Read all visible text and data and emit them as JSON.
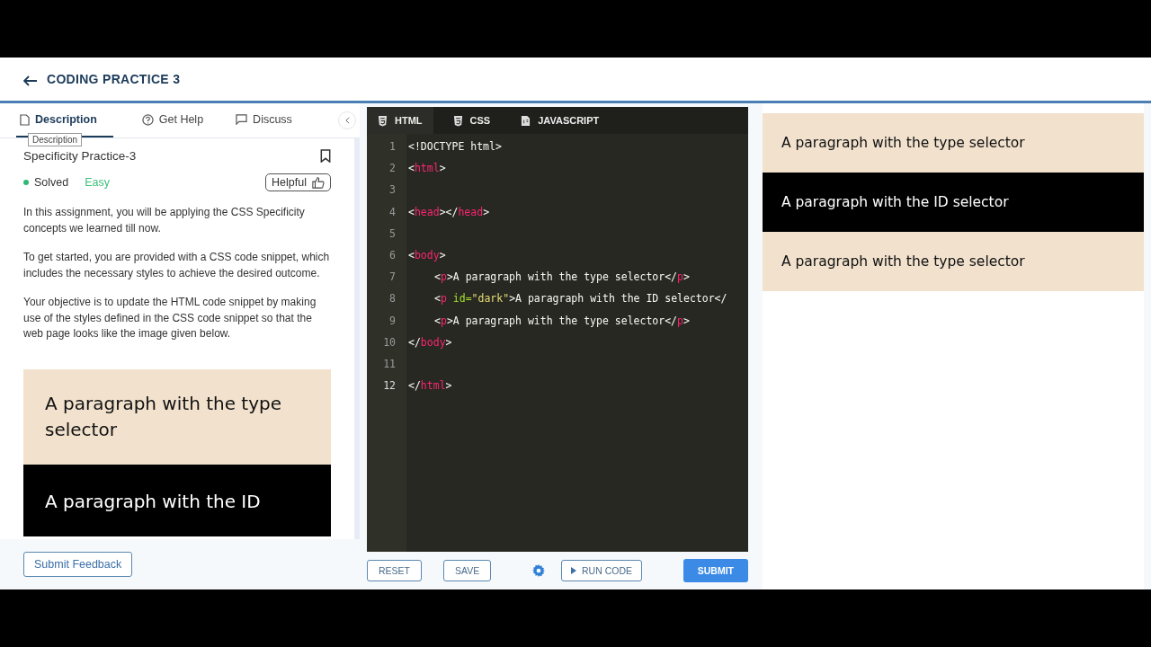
{
  "header": {
    "title": "CODING PRACTICE 3"
  },
  "left_tabs": [
    {
      "label": "Description",
      "kind": "doc",
      "selected": true
    },
    {
      "label": "Get Help",
      "kind": "help",
      "selected": false
    },
    {
      "label": "Discuss",
      "kind": "chat",
      "selected": false
    }
  ],
  "tooltip": "Description",
  "problem": {
    "title": "Specificity Practice-3",
    "status": "Solved",
    "difficulty": "Easy",
    "helpful": "Helpful",
    "paragraphs": [
      "In this assignment, you will be applying the CSS Specificity concepts we learned till now.",
      "To get started, you are provided with a CSS code snippet, which includes the necessary styles to achieve the desired outcome.",
      "Your objective is to update the HTML code snippet by making use of the styles defined in the CSS code snippet so that the web page looks like the image given below."
    ],
    "sample": [
      {
        "text": "A paragraph with the type selector",
        "kind": "light"
      },
      {
        "text": "A paragraph with the ID",
        "kind": "dark"
      }
    ]
  },
  "feedback_button": "Submit Feedback",
  "editor_tabs": [
    {
      "label": "HTML",
      "kind": "html",
      "selected": true
    },
    {
      "label": "CSS",
      "kind": "css",
      "selected": false
    },
    {
      "label": "JAVASCRIPT",
      "kind": "js",
      "selected": false
    }
  ],
  "code_lines": [
    {
      "n": "1",
      "indent": false,
      "tokens": [
        {
          "kind": "punct",
          "text": "<!DOCTYPE html>"
        }
      ]
    },
    {
      "n": "2",
      "indent": false,
      "tokens": [
        {
          "kind": "punct",
          "text": "<"
        },
        {
          "kind": "tag",
          "text": "html"
        },
        {
          "kind": "punct",
          "text": ">"
        }
      ]
    },
    {
      "n": "3"
    },
    {
      "n": "4",
      "indent": false,
      "tokens": [
        {
          "kind": "punct",
          "text": "<"
        },
        {
          "kind": "tag",
          "text": "head"
        },
        {
          "kind": "punct",
          "text": "></"
        },
        {
          "kind": "tag",
          "text": "head"
        },
        {
          "kind": "punct",
          "text": ">"
        }
      ]
    },
    {
      "n": "5"
    },
    {
      "n": "6",
      "indent": false,
      "tokens": [
        {
          "kind": "punct",
          "text": "<"
        },
        {
          "kind": "tag",
          "text": "body"
        },
        {
          "kind": "punct",
          "text": ">"
        }
      ]
    },
    {
      "n": "7",
      "indent": true,
      "tokens": [
        {
          "kind": "punct",
          "text": "<"
        },
        {
          "kind": "tag",
          "text": "p"
        },
        {
          "kind": "punct",
          "text": ">A paragraph with the type selector</"
        },
        {
          "kind": "tag",
          "text": "p"
        },
        {
          "kind": "punct",
          "text": ">"
        }
      ]
    },
    {
      "n": "8",
      "indent": true,
      "tokens": [
        {
          "kind": "punct",
          "text": "<"
        },
        {
          "kind": "tag",
          "text": "p"
        },
        {
          "kind": "attr",
          "text": " id="
        },
        {
          "kind": "string",
          "text": "\"dark\""
        },
        {
          "kind": "punct",
          "text": ">A paragraph with the ID selector</"
        }
      ]
    },
    {
      "n": "9",
      "indent": true,
      "tokens": [
        {
          "kind": "punct",
          "text": "<"
        },
        {
          "kind": "tag",
          "text": "p"
        },
        {
          "kind": "punct",
          "text": ">A paragraph with the type selector</"
        },
        {
          "kind": "tag",
          "text": "p"
        },
        {
          "kind": "punct",
          "text": ">"
        }
      ]
    },
    {
      "n": "10",
      "indent": false,
      "tokens": [
        {
          "kind": "punct",
          "text": "</"
        },
        {
          "kind": "tag",
          "text": "body"
        },
        {
          "kind": "punct",
          "text": ">"
        }
      ]
    },
    {
      "n": "11"
    },
    {
      "n": "12",
      "indent": false,
      "tokens": [
        {
          "kind": "punct",
          "text": "</"
        },
        {
          "kind": "tag",
          "text": "html"
        },
        {
          "kind": "punct",
          "text": ">"
        }
      ]
    }
  ],
  "editor_buttons": [
    {
      "label": "RESET",
      "kind": "outline"
    },
    {
      "label": "SAVE",
      "kind": "outline"
    },
    {
      "kind": "gear"
    },
    {
      "label": "RUN CODE",
      "kind": "run"
    },
    {
      "label": "SUBMIT",
      "kind": "primary"
    }
  ],
  "preview": [
    {
      "text": "A paragraph with the type selector",
      "kind": "light"
    },
    {
      "text": "A paragraph with the ID selector",
      "kind": "dark"
    },
    {
      "text": "A paragraph with the type selector",
      "kind": "light"
    }
  ]
}
